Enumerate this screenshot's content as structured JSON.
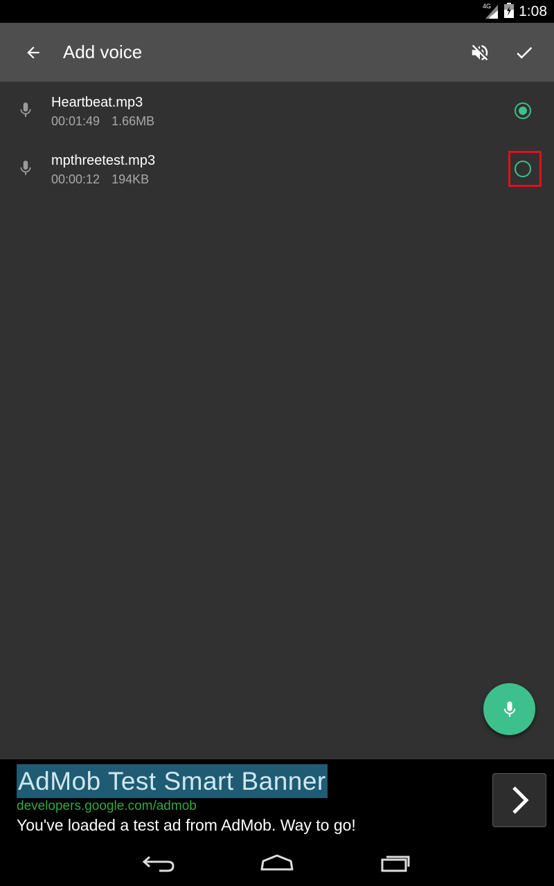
{
  "status_bar": {
    "network": "4G",
    "time": "1:08"
  },
  "app_bar": {
    "title": "Add voice"
  },
  "files": [
    {
      "name": "Heartbeat.mp3",
      "duration": "00:01:49",
      "size": "1.66MB",
      "selected": true
    },
    {
      "name": "mpthreetest.mp3",
      "duration": "00:00:12",
      "size": "194KB",
      "selected": false
    }
  ],
  "ad": {
    "title": "AdMob Test Smart Banner",
    "url": "developers.google.com/admob",
    "text": "You've loaded a test ad from AdMob. Way to go!"
  },
  "colors": {
    "accent": "#3ec08c",
    "highlight": "#e0101c",
    "app_bar": "#4d4e4d",
    "background": "#313131"
  }
}
